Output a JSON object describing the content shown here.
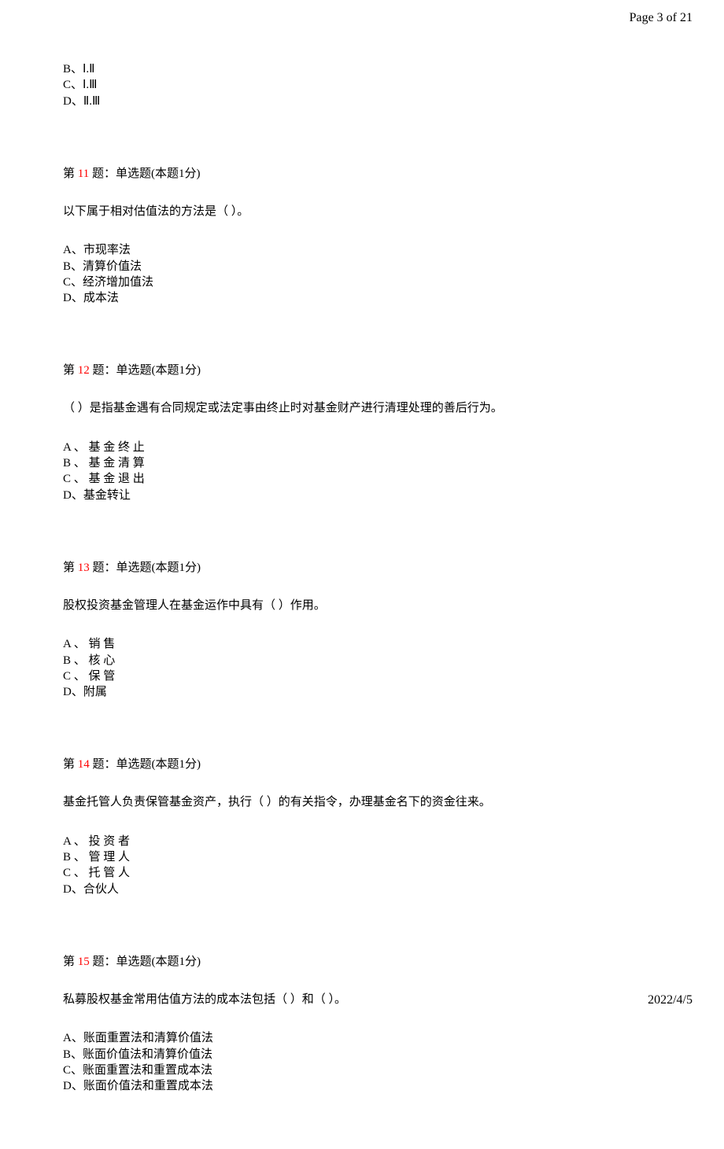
{
  "header": {
    "pageIndicator": "Page 3 of 21"
  },
  "partialQuestion": {
    "options": [
      "B、Ⅰ.Ⅱ",
      "C、Ⅰ.Ⅲ",
      "D、Ⅱ.Ⅲ"
    ]
  },
  "questions": [
    {
      "prefix": "第 ",
      "number": "11",
      "suffix": " 题：单选题(本题1分)",
      "stem": "以下属于相对估值法的方法是（ ）。",
      "options": [
        "A、市现率法",
        "B、清算价值法",
        "C、经济增加值法",
        "D、成本法"
      ]
    },
    {
      "prefix": "第 ",
      "number": "12",
      "suffix": " 题：单选题(本题1分)",
      "stem": "（ ）是指基金遇有合同规定或法定事由终止时对基金财产进行清理处理的善后行为。",
      "options": [
        "A 、 基 金 终 止",
        "B 、 基 金 清 算",
        "C 、 基 金 退 出",
        "D、基金转让"
      ]
    },
    {
      "prefix": "第 ",
      "number": "13",
      "suffix": " 题：单选题(本题1分)",
      "stem": "股权投资基金管理人在基金运作中具有（ ）作用。",
      "options": [
        "A 、 销 售",
        "B 、 核 心",
        "C 、 保 管",
        "D、附属"
      ]
    },
    {
      "prefix": "第 ",
      "number": "14",
      "suffix": " 题：单选题(本题1分)",
      "stem": "基金托管人负责保管基金资产，执行（ ）的有关指令，办理基金名下的资金往来。",
      "options": [
        "A 、 投 资 者",
        "B 、 管 理 人",
        "C 、 托 管 人",
        "D、合伙人"
      ]
    },
    {
      "prefix": "第 ",
      "number": "15",
      "suffix": " 题：单选题(本题1分)",
      "stem": "私募股权基金常用估值方法的成本法包括（ ）和（ ）。",
      "options": [
        "A、账面重置法和清算价值法",
        "B、账面价值法和清算价值法",
        "C、账面重置法和重置成本法",
        "D、账面价值法和重置成本法"
      ]
    }
  ],
  "footer": {
    "date": "2022/4/5"
  }
}
